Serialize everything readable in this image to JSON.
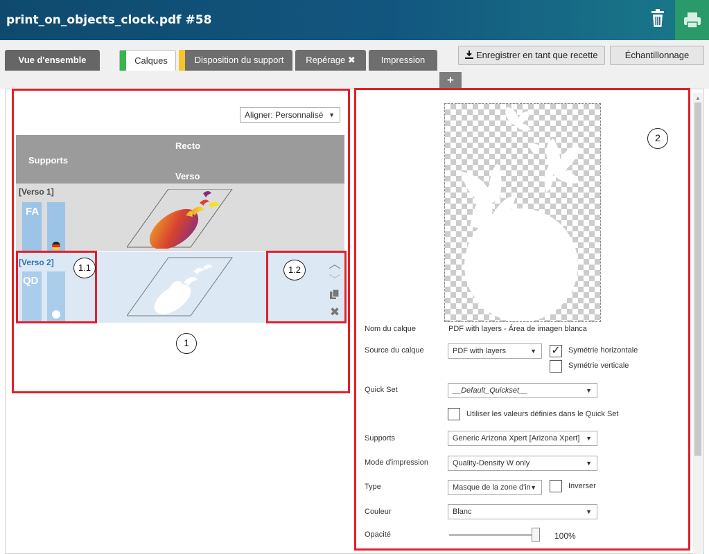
{
  "header": {
    "title": "print_on_objects_clock.pdf #58",
    "trash_icon": "trash-icon",
    "print_icon": "printer-icon"
  },
  "tabs": [
    {
      "label": "Vue d'ensemble"
    },
    {
      "label": "Calques",
      "marker_color": "#39b54a"
    },
    {
      "label": "Disposition du support",
      "marker_color": "#f7c52b"
    },
    {
      "label": "Repérage ✖"
    },
    {
      "label": "Impression"
    }
  ],
  "toolbar": {
    "save_recipe": "Enregistrer en tant que recette",
    "sampling": "Échantillonnage",
    "add": "+"
  },
  "left": {
    "align_select": "Aligner: Personnalisé",
    "table": {
      "col_supports": "Supports",
      "col_recto": "Recto",
      "col_verso": "Verso"
    },
    "rows": [
      {
        "label": "[Verso 1]",
        "support": "FA"
      },
      {
        "label": "[Verso 2]",
        "support": "QD"
      }
    ]
  },
  "callouts": {
    "c1": "1",
    "c11": "1.1",
    "c12": "1.2",
    "c2": "2"
  },
  "right": {
    "layer_name_label": "Nom du calque",
    "layer_name_value": "PDF with layers - Área de imagen blanca",
    "source_label": "Source du calque",
    "source_value": "PDF with layers",
    "mirror_h": "Symétrie horizontale",
    "mirror_v": "Symétrie verticale",
    "quickset_label": "Quick Set",
    "quickset_value": "__Default_Quickset__",
    "use_quickset": "Utiliser les valeurs définies dans le Quick Set",
    "media_label": "Supports",
    "media_value": "Generic Arizona Xpert [Arizona Xpert]",
    "mode_label": "Mode d'impression",
    "mode_value": "Quality-Density W only",
    "type_label": "Type",
    "type_value": "Masque de la zone d'in",
    "invert_label": "Inverser",
    "color_label": "Couleur",
    "color_value": "Blanc",
    "opacity_label": "Opacité",
    "opacity_value": "100%"
  }
}
